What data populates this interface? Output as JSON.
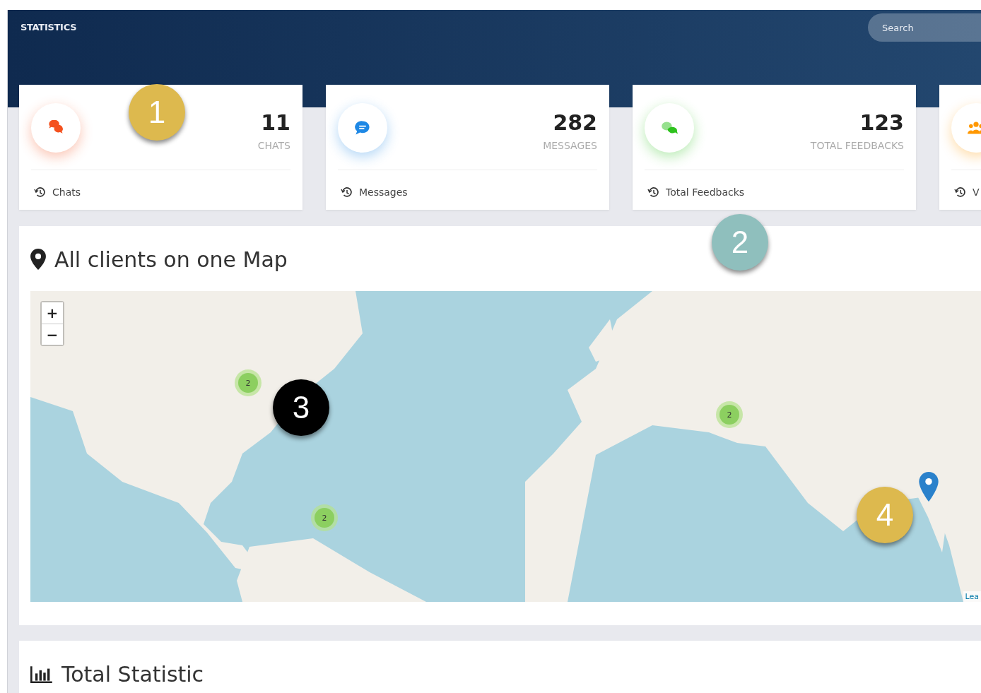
{
  "header": {
    "title": "STATISTICS",
    "search": {
      "placeholder": "Search"
    }
  },
  "stat_cards": [
    {
      "kind": "chats",
      "color": "#f4511e",
      "value": "11",
      "label": "CHATS",
      "footer": "Chats"
    },
    {
      "kind": "message",
      "color": "#1e88e5",
      "value": "282",
      "label": "MESSAGES",
      "footer": "Messages"
    },
    {
      "kind": "feedback",
      "color": "#2ec21e",
      "value": "123",
      "label": "TOTAL FEEDBACKS",
      "footer": "Total Feedbacks"
    },
    {
      "kind": "users",
      "color": "#ff9800",
      "footer": "V"
    }
  ],
  "map_panel": {
    "title": "All clients on one Map",
    "zoom_in": "+",
    "zoom_out": "−",
    "clusters": [
      {
        "count": "2"
      },
      {
        "count": "2"
      },
      {
        "count": "2"
      }
    ],
    "attribution": "Lea"
  },
  "stats_panel": {
    "title": "Total Statistic"
  },
  "callouts": [
    {
      "number": "1",
      "color": "#ddb94e"
    },
    {
      "number": "2",
      "color": "#8fbfbd"
    },
    {
      "number": "3",
      "color": "#000000"
    },
    {
      "number": "4",
      "color": "#ddb94e"
    }
  ]
}
